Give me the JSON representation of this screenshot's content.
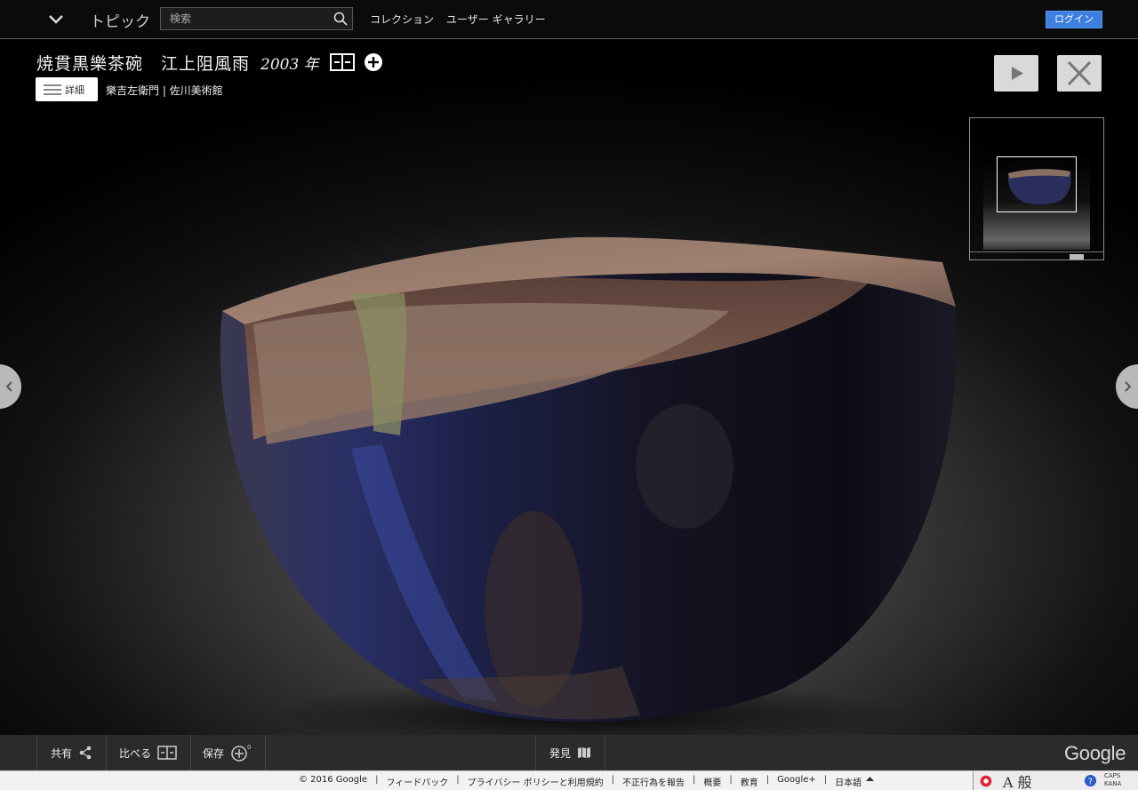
{
  "nav": {
    "topic_label": "トピック",
    "search_placeholder": "検索",
    "collection_label": "コレクション",
    "gallery_label": "ユーザー ギャラリー",
    "login_label": "ログイン"
  },
  "artwork": {
    "title": "焼貫黒樂茶碗　江上阻風雨",
    "year": "2003 年",
    "details_label": "詳細",
    "artist_line": "樂吉左衛門 | 佐川美術館"
  },
  "toolbar": {
    "share_label": "共有",
    "compare_label": "比べる",
    "save_label": "保存",
    "save_count": "0",
    "discover_label": "発見",
    "logo_text": "Google"
  },
  "footer": {
    "links": [
      "© 2016 Google",
      "フィードバック",
      "プライバシー ポリシーと利用規約",
      "不正行為を報告",
      "概要",
      "教育",
      "Google+",
      "日本語"
    ]
  },
  "ime": {
    "mode_a": "A",
    "mode_kanji": "般",
    "caps_label": "CAPS",
    "kana_label": "KANA"
  },
  "colors": {
    "login_blue": "#3d7fe0",
    "toolbar_bg": "#2b2b2b",
    "topbar_bg": "#0b0b0b"
  }
}
